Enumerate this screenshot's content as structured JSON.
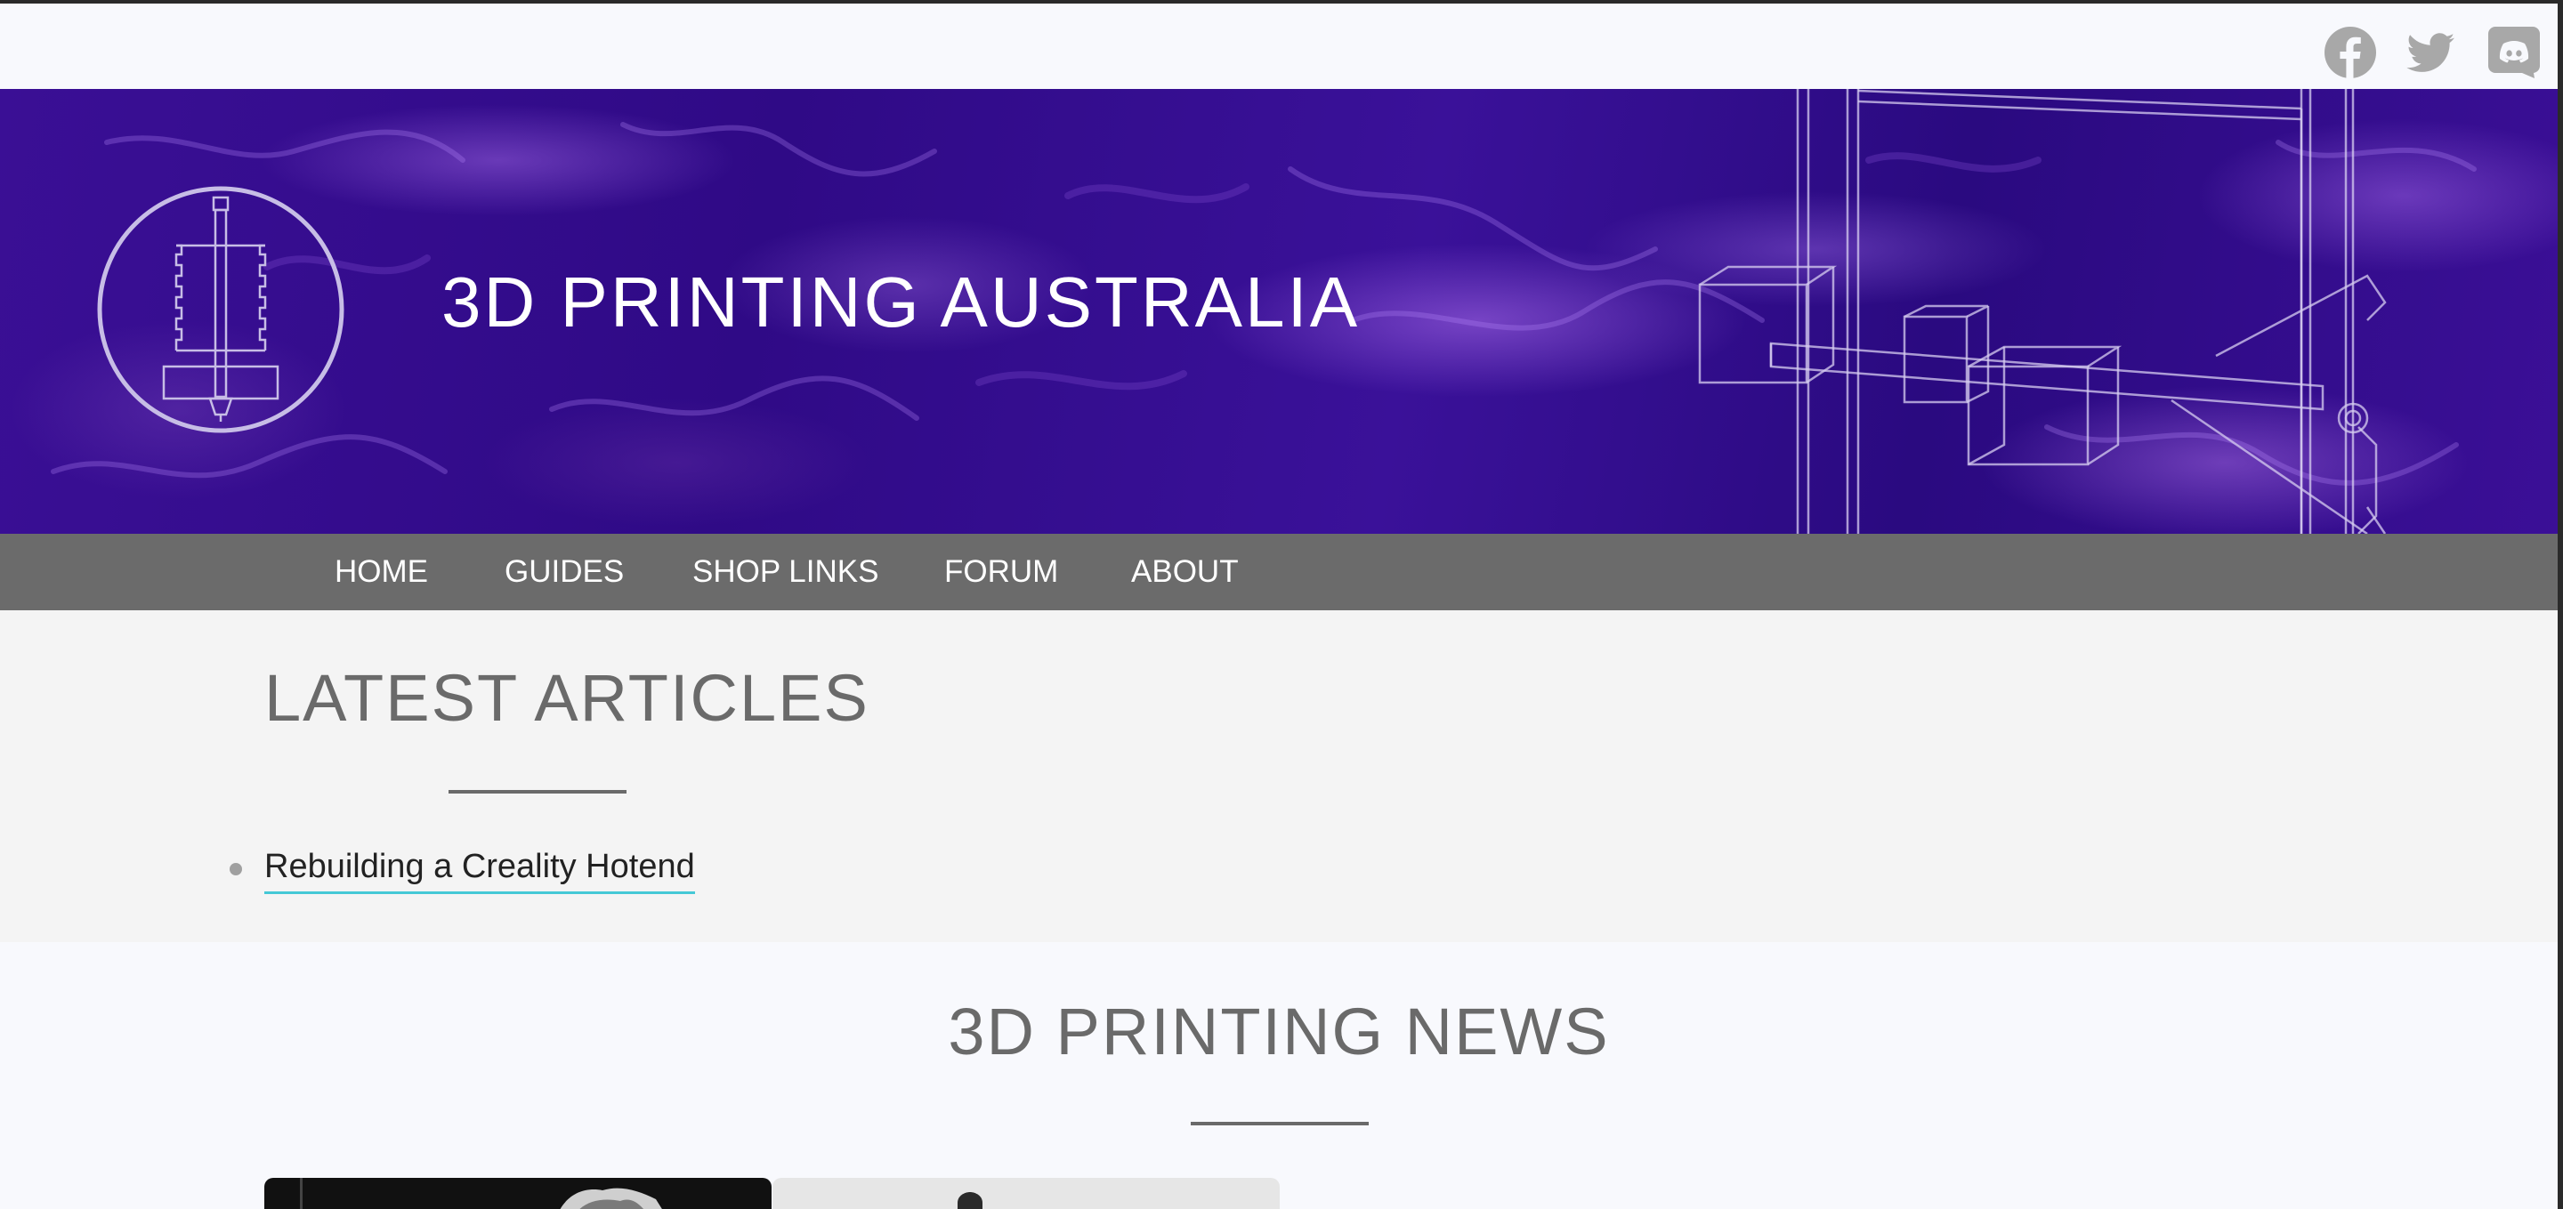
{
  "social": {
    "icons": [
      "facebook-icon",
      "twitter-icon",
      "discord-icon"
    ],
    "color": "#a8a8a8"
  },
  "header": {
    "title": "3D PRINTING AUSTRALIA",
    "logo_icon": "hotend-logo-icon",
    "background_color": "#34108f"
  },
  "nav": {
    "items": [
      {
        "label": "HOME"
      },
      {
        "label": "GUIDES"
      },
      {
        "label": "SHOP LINKS"
      },
      {
        "label": "FORUM"
      },
      {
        "label": "ABOUT"
      }
    ],
    "background_color": "#6b6b6b"
  },
  "latest": {
    "title": "LATEST ARTICLES",
    "articles": [
      {
        "label": "Rebuilding a Creality Hotend"
      }
    ],
    "link_underline_color": "#45c8d6"
  },
  "news": {
    "title": "3D PRINTING NEWS"
  }
}
